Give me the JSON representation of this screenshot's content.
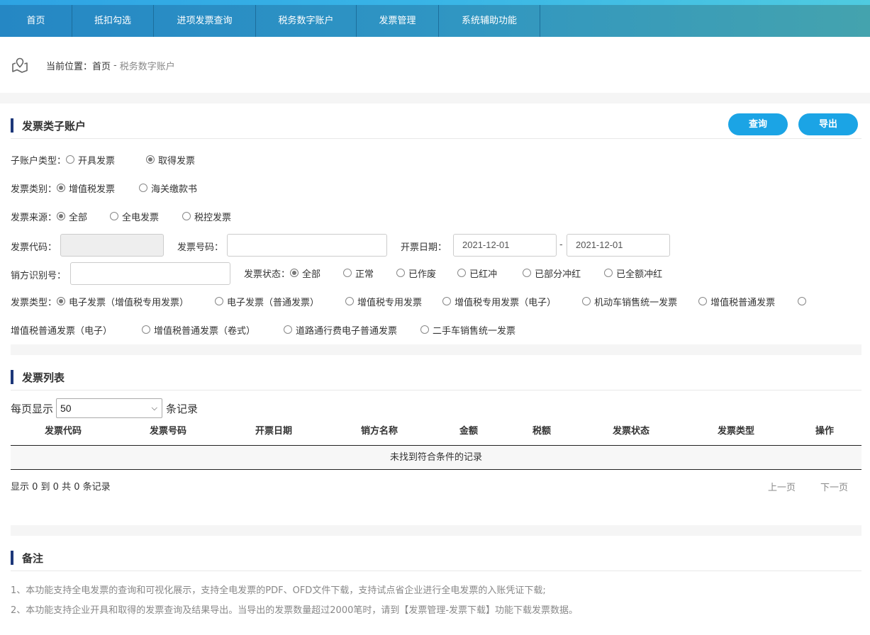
{
  "nav": {
    "items": [
      {
        "label": "首页"
      },
      {
        "label": "抵扣勾选"
      },
      {
        "label": "进项发票查询"
      },
      {
        "label": "税务数字账户"
      },
      {
        "label": "发票管理"
      },
      {
        "label": "系统辅助功能"
      }
    ]
  },
  "breadcrumb": {
    "label": "当前位置：",
    "home": "首页",
    "separator": "-",
    "current": "税务数字账户"
  },
  "filter_section": {
    "title": "发票类子账户",
    "query_button": "查询",
    "export_button": "导出",
    "subaccount_type": {
      "label": "子账户类型：",
      "options": [
        "开具发票",
        "取得发票"
      ],
      "selected": "取得发票"
    },
    "invoice_category": {
      "label": "发票类别：",
      "options": [
        "增值税发票",
        "海关缴款书"
      ],
      "selected": "增值税发票"
    },
    "invoice_source": {
      "label": "发票来源：",
      "options": [
        "全部",
        "全电发票",
        "税控发票"
      ],
      "selected": "全部"
    },
    "invoice_code": {
      "label": "发票代码：",
      "value": ""
    },
    "invoice_number": {
      "label": "发票号码：",
      "value": ""
    },
    "issue_date": {
      "label": "开票日期：",
      "start": "2021-12-01",
      "separator": "-",
      "end": "2021-12-01"
    },
    "seller_tax_id": {
      "label": "销方识别号：",
      "value": ""
    },
    "invoice_status": {
      "label": "发票状态：",
      "options": [
        "全部",
        "正常",
        "已作废",
        "已红冲",
        "已部分冲红",
        "已全额冲红"
      ],
      "selected": "全部"
    },
    "invoice_type": {
      "label": "发票类型：",
      "options": [
        "电子发票（增值税专用发票）",
        "电子发票（普通发票）",
        "增值税专用发票",
        "增值税专用发票（电子）",
        "机动车销售统一发票",
        "增值税普通发票",
        "增值税普通发票（电子）",
        "增值税普通发票（卷式）",
        "道路通行费电子普通发票",
        "二手车销售统一发票"
      ],
      "selected": "电子发票（增值税专用发票）"
    }
  },
  "list_section": {
    "title": "发票列表",
    "per_page_prefix": "每页显示",
    "per_page_value": "50",
    "per_page_suffix": "条记录",
    "columns": [
      "发票代码",
      "发票号码",
      "开票日期",
      "销方名称",
      "金额",
      "税额",
      "发票状态",
      "发票类型",
      "操作"
    ],
    "rows": [],
    "empty_text": "未找到符合条件的记录",
    "info": "显示 0 到 0 共 0 条记录",
    "prev": "上一页",
    "next": "下一页"
  },
  "notes_section": {
    "title": "备注",
    "notes": [
      "1、本功能支持全电发票的查询和可视化展示，支持全电发票的PDF、OFD文件下载，支持试点省企业进行全电发票的入账凭证下载;",
      "2、本功能支持企业开具和取得的发票查询及结果导出。当导出的发票数量超过2000笔时，请到【发票管理-发票下载】功能下载发票数据。"
    ]
  },
  "colors": {
    "nav_start": "#2587c4",
    "nav_end": "#44a3ae",
    "button": "#1ba4e5",
    "section_bar": "#1d3779"
  }
}
